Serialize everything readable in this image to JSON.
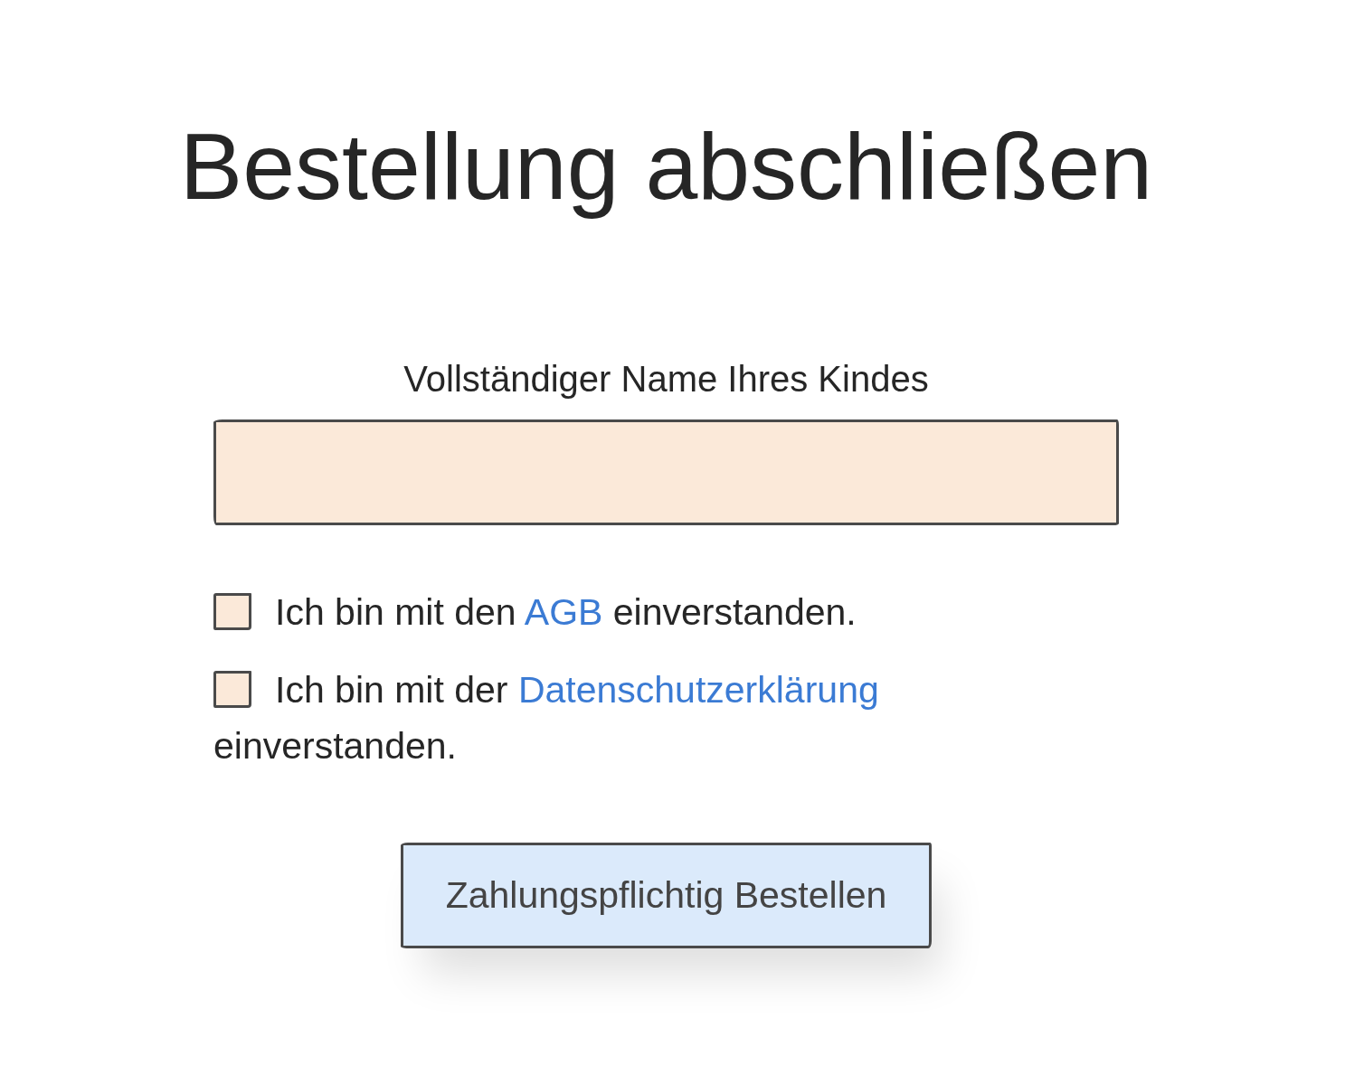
{
  "title": "Bestellung abschließen",
  "name_field": {
    "label": "Vollständiger Name Ihres Kindes"
  },
  "consents": [
    {
      "checked": false,
      "text": "Ich bin mit den",
      "link": "AGB",
      "text_after": "einverstanden."
    },
    {
      "checked": false,
      "text": "Ich bin mit der",
      "link": "Datenschutzerklärung",
      "text_after": "einverstanden."
    }
  ],
  "submit_button": {
    "label": "Zahlungspflichtig Bestellen"
  }
}
